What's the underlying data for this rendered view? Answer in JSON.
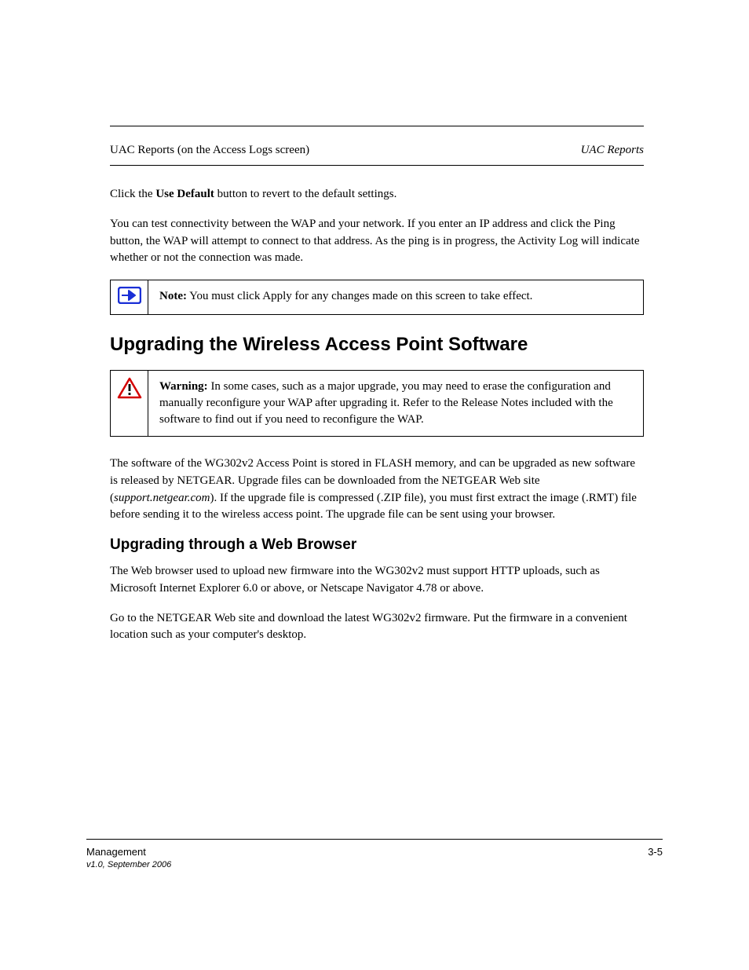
{
  "table_row": {
    "label": "UAC Reports (on the Access Logs screen)",
    "value": "UAC Reports"
  },
  "para1_before_bold": "Click the ",
  "para1_bold": "Use Default",
  "para1_after_bold": " button to revert to the default settings.",
  "para2": "You can test connectivity between the WAP and your network. If you enter an IP address and click the Ping button, the WAP will attempt to connect to that address. As the ping is in progress, the Activity Log will indicate whether or not the connection was made.",
  "note": {
    "lead": "Note:",
    "text": " You must click Apply for any changes made on this screen to take effect."
  },
  "section_title": "Upgrading the Wireless Access Point Software",
  "warning": {
    "lead": "Warning:",
    "text": " In some cases, such as a major upgrade, you may need to erase the configuration and manually reconfigure your WAP after upgrading it. Refer to the Release Notes included with the software to find out if you need to reconfigure the WAP."
  },
  "para3_before_link": "The software of the WG302v2 Access Point is stored in FLASH memory, and can be upgraded as new software is released by NETGEAR. Upgrade files can be downloaded from the NETGEAR Web site (",
  "para3_link": "support.netgear.com",
  "para3_after_link": "). If the upgrade file is compressed (.ZIP file), you must first extract the image (.RMT) file before sending it to the wireless access point. The upgrade file can be sent using your browser.",
  "subheading": "Upgrading through a Web Browser",
  "para4": "The Web browser used to upload new firmware into the WG302v2 must support HTTP uploads, such as Microsoft Internet Explorer 6.0 or above, or Netscape Navigator 4.78 or above.",
  "para5": "Go to the NETGEAR Web site and download the latest WG302v2 firmware. Put the firmware in a convenient location such as your computer's desktop.",
  "footer": {
    "left": "Management",
    "right": "3-5"
  },
  "version": "v1.0, September 2006"
}
